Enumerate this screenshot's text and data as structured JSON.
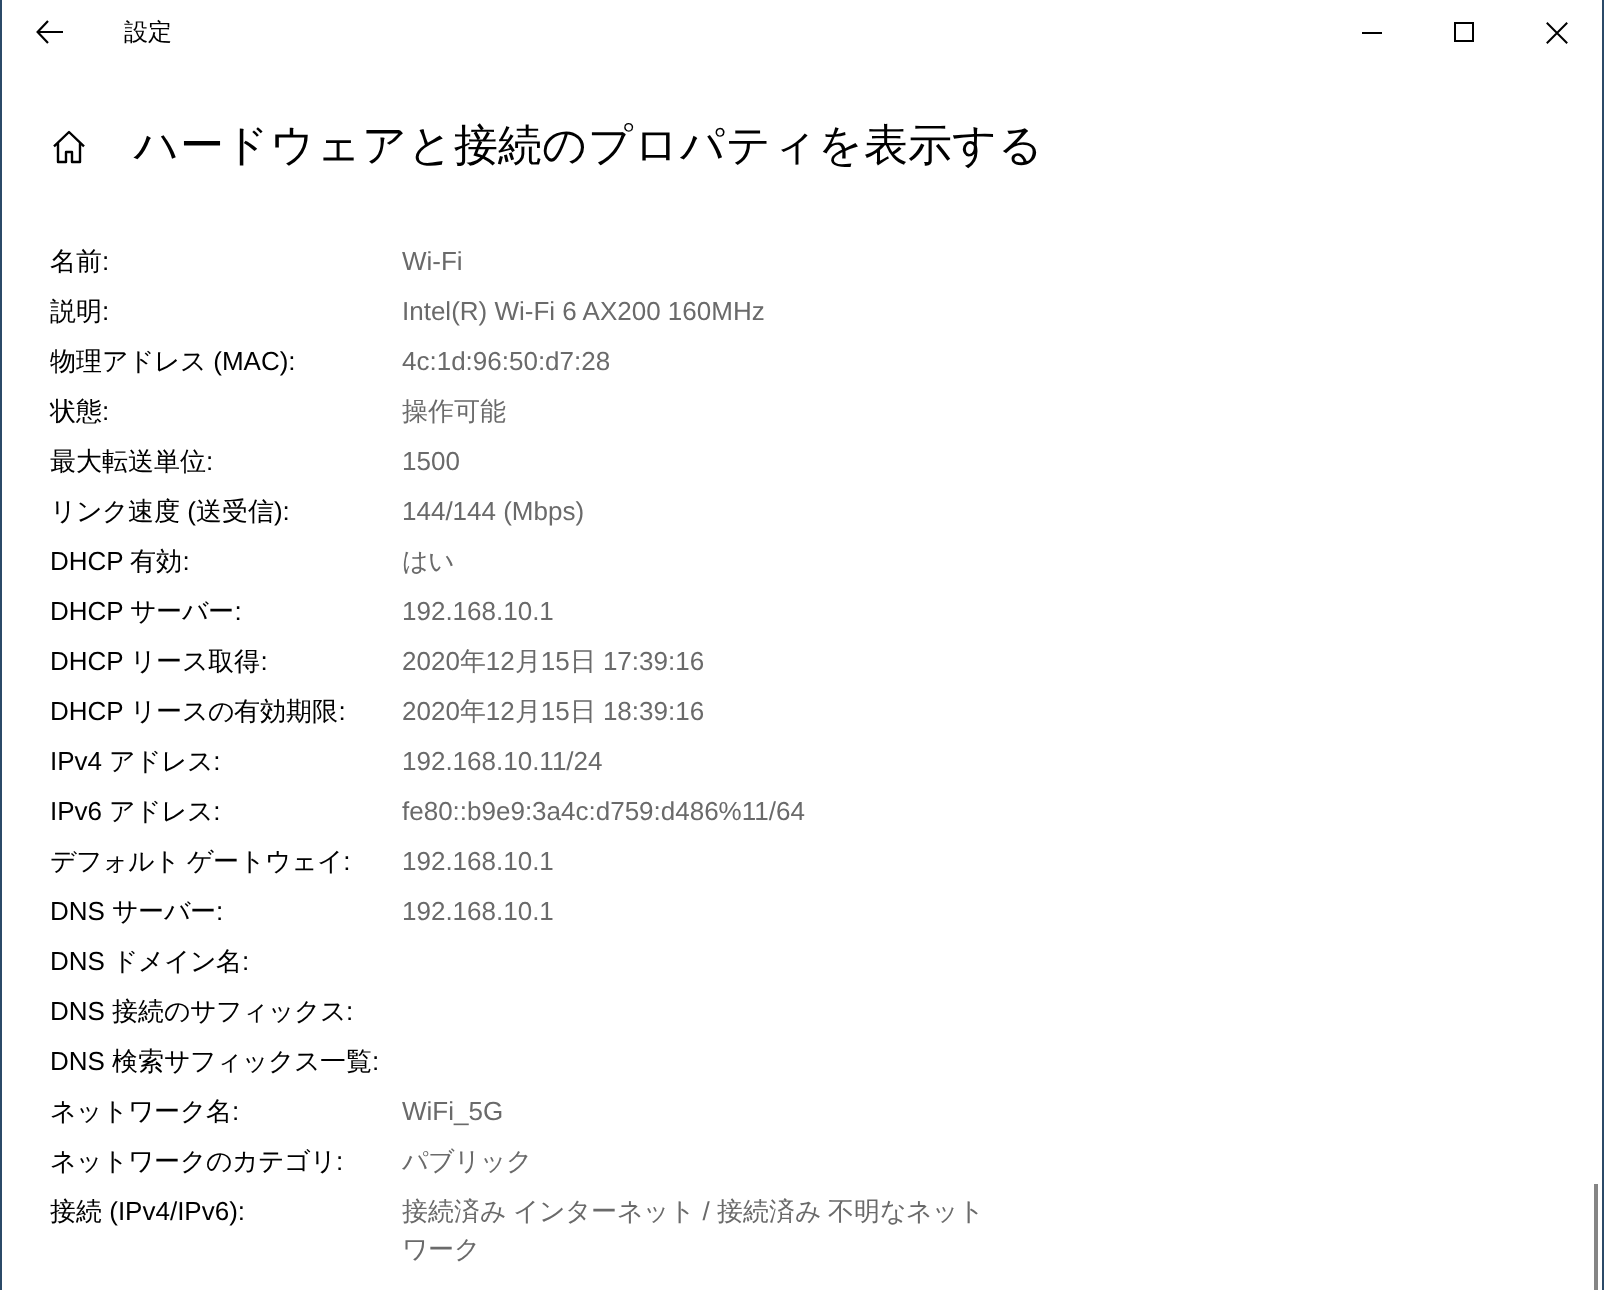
{
  "window": {
    "title": "設定"
  },
  "page": {
    "heading": "ハードウェアと接続のプロパティを表示する"
  },
  "properties": [
    {
      "label": "名前:",
      "value": "Wi-Fi"
    },
    {
      "label": "説明:",
      "value": "Intel(R) Wi-Fi 6 AX200 160MHz"
    },
    {
      "label": "物理アドレス (MAC):",
      "value": "4c:1d:96:50:d7:28"
    },
    {
      "label": "状態:",
      "value": "操作可能"
    },
    {
      "label": "最大転送単位:",
      "value": "1500"
    },
    {
      "label": "リンク速度 (送受信):",
      "value": "144/144 (Mbps)"
    },
    {
      "label": "DHCP 有効:",
      "value": "はい"
    },
    {
      "label": "DHCP サーバー:",
      "value": "192.168.10.1"
    },
    {
      "label": "DHCP リース取得:",
      "value": "2020年12月15日 17:39:16"
    },
    {
      "label": "DHCP リースの有効期限:",
      "value": "2020年12月15日 18:39:16"
    },
    {
      "label": "IPv4 アドレス:",
      "value": "192.168.10.11/24"
    },
    {
      "label": "IPv6 アドレス:",
      "value": "fe80::b9e9:3a4c:d759:d486%11/64"
    },
    {
      "label": "デフォルト ゲートウェイ:",
      "value": "192.168.10.1"
    },
    {
      "label": "DNS サーバー:",
      "value": "192.168.10.1"
    },
    {
      "label": "DNS ドメイン名:"
    },
    {
      "label": "DNS 接続のサフィックス:"
    },
    {
      "label": "DNS 検索サフィックス一覧:"
    },
    {
      "label": "ネットワーク名:",
      "value": "WiFi_5G"
    },
    {
      "label": "ネットワークのカテゴリ:",
      "value": "パブリック"
    },
    {
      "label": "接続 (IPv4/IPv6):",
      "value": "接続済み インターネット / 接続済み 不明なネットワーク"
    }
  ]
}
